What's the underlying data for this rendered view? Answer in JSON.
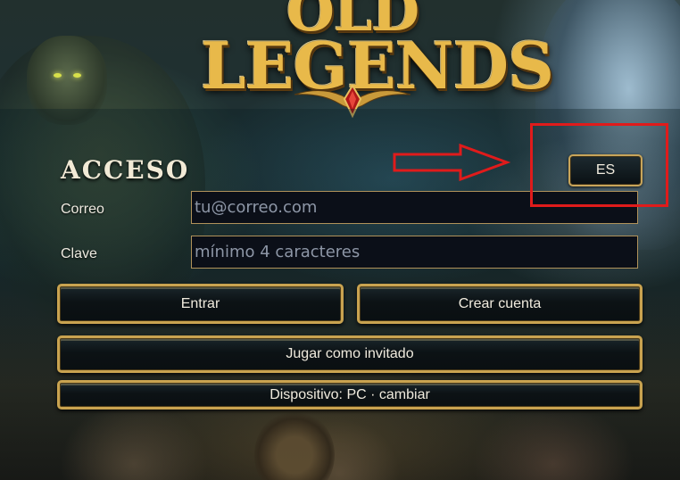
{
  "logo": {
    "line1": "OLD",
    "line2": "LEGENDS"
  },
  "login": {
    "title": "ACCESO",
    "language_button": "ES",
    "email": {
      "label": "Correo",
      "placeholder": "tu@correo.com",
      "value": ""
    },
    "password": {
      "label": "Clave",
      "placeholder": "mínimo 4 caracteres",
      "value": ""
    },
    "enter_button": "Entrar",
    "create_account_button": "Crear cuenta",
    "guest_button": "Jugar como invitado",
    "device_button": "Dispositivo: PC · cambiar"
  },
  "colors": {
    "gold_border": "#c9a350",
    "annotation_red": "#e01b1b",
    "field_background": "#0b0f18"
  }
}
